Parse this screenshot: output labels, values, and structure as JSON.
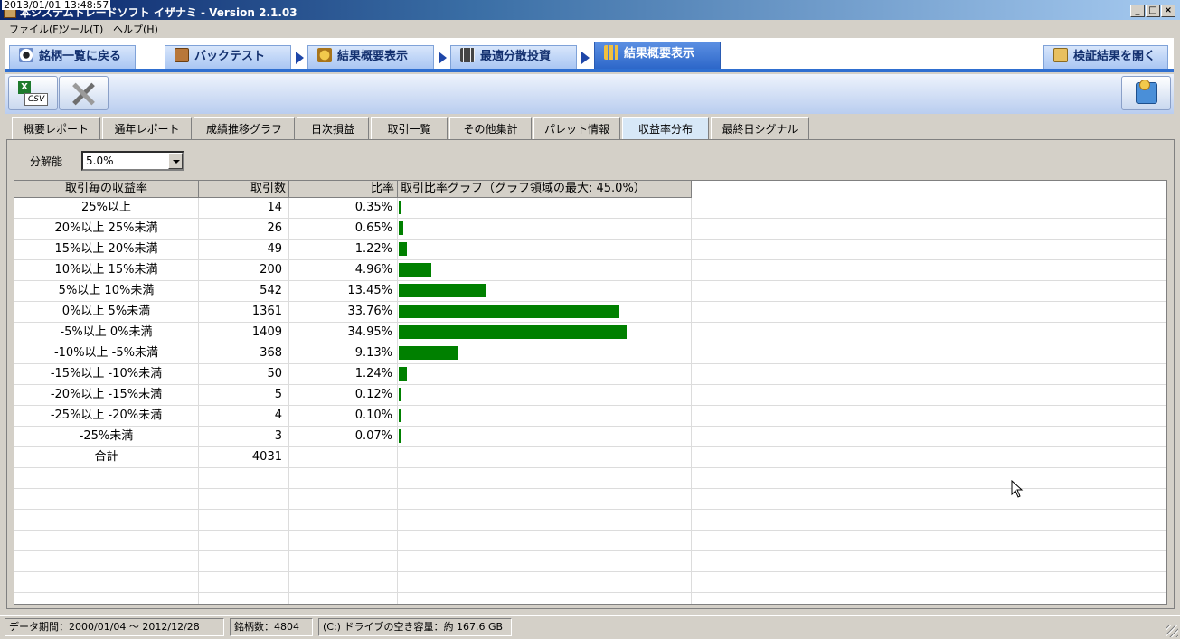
{
  "window": {
    "timestamp": "2013/01/01 13:48:57",
    "title": "本システムトレードソフト イザナミ - Version 2.1.03"
  },
  "menu": [
    {
      "label": "ファイル(F)"
    },
    {
      "label": "ツール(T)"
    },
    {
      "label": "ヘルプ(H)"
    }
  ],
  "main_tabs": [
    {
      "label": "銘柄一覧に戻る",
      "icon": "eye-icon"
    },
    {
      "label": "バックテスト",
      "icon": "bag-icon"
    },
    {
      "label": "結果概要表示",
      "icon": "coins-icon"
    },
    {
      "label": "最適分散投資",
      "icon": "grid-icon"
    },
    {
      "label": "結果概要表示",
      "icon": "bar-chart-icon",
      "active": true
    }
  ],
  "open_results_label": "検証結果を開く",
  "toolbar": {
    "csv_label": "CSV",
    "tools_icon": "tools-icon",
    "export_icon": "money-box-icon"
  },
  "sub_tabs": [
    {
      "label": "概要レポート"
    },
    {
      "label": "通年レポート"
    },
    {
      "label": "成績推移グラフ"
    },
    {
      "label": "日次損益"
    },
    {
      "label": "取引一覧"
    },
    {
      "label": "その他集計"
    },
    {
      "label": "パレット情報"
    },
    {
      "label": "収益率分布",
      "active": true
    },
    {
      "label": "最終日シグナル"
    }
  ],
  "resolution": {
    "label": "分解能",
    "value": "5.0%"
  },
  "table": {
    "headers": [
      "取引毎の収益率",
      "取引数",
      "比率",
      "取引比率グラフ（グラフ領域の最大: 45.0%）"
    ],
    "graph_max_pct": 45.0,
    "rows": [
      {
        "range": "25%以上",
        "count": "14",
        "ratio": "0.35%",
        "pct": 0.35
      },
      {
        "range": "20%以上 25%未満",
        "count": "26",
        "ratio": "0.65%",
        "pct": 0.65
      },
      {
        "range": "15%以上 20%未満",
        "count": "49",
        "ratio": "1.22%",
        "pct": 1.22
      },
      {
        "range": "10%以上 15%未満",
        "count": "200",
        "ratio": "4.96%",
        "pct": 4.96
      },
      {
        "range": "5%以上 10%未満",
        "count": "542",
        "ratio": "13.45%",
        "pct": 13.45
      },
      {
        "range": "0%以上 5%未満",
        "count": "1361",
        "ratio": "33.76%",
        "pct": 33.76
      },
      {
        "range": "-5%以上 0%未満",
        "count": "1409",
        "ratio": "34.95%",
        "pct": 34.95
      },
      {
        "range": "-10%以上 -5%未満",
        "count": "368",
        "ratio": "9.13%",
        "pct": 9.13
      },
      {
        "range": "-15%以上 -10%未満",
        "count": "50",
        "ratio": "1.24%",
        "pct": 1.24
      },
      {
        "range": "-20%以上 -15%未満",
        "count": "5",
        "ratio": "0.12%",
        "pct": 0.12
      },
      {
        "range": "-25%以上 -20%未満",
        "count": "4",
        "ratio": "0.10%",
        "pct": 0.1
      },
      {
        "range": "-25%未満",
        "count": "3",
        "ratio": "0.07%",
        "pct": 0.07
      },
      {
        "range": "合計",
        "count": "4031",
        "ratio": "",
        "pct": 0
      }
    ],
    "empty_rows": 7,
    "bar_color": "#008000"
  },
  "status": {
    "period": "データ期間：2000/01/04 〜 2012/12/28",
    "stocks": "銘柄数：4804",
    "disk": "(C:) ドライブの空き容量：約 167.6 GB"
  }
}
